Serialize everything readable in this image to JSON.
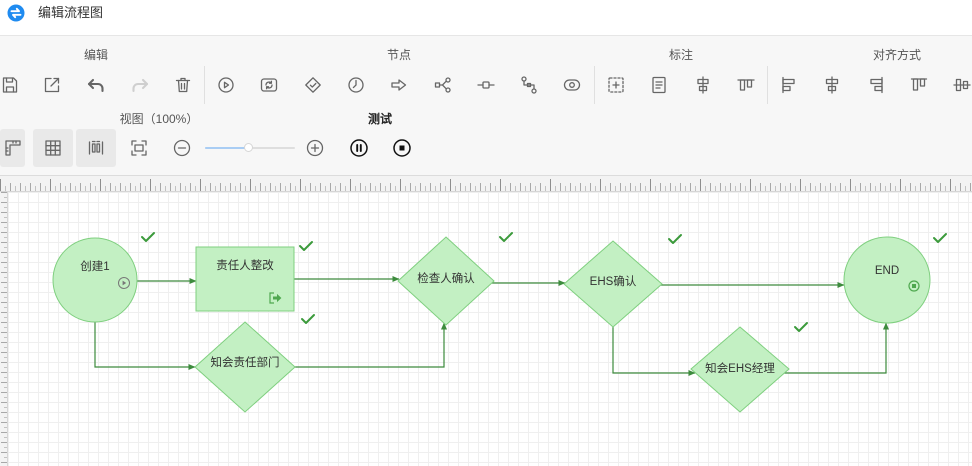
{
  "app": {
    "title": "编辑流程图",
    "logo_icon": "app-logo-icon"
  },
  "toolbar": {
    "edit": {
      "label": "编辑",
      "buttons": [
        {
          "icon": "save-icon"
        },
        {
          "icon": "export-icon"
        },
        {
          "icon": "undo-icon"
        },
        {
          "icon": "redo-icon",
          "disabled": true
        },
        {
          "icon": "delete-icon"
        }
      ]
    },
    "node": {
      "label": "节点",
      "buttons": [
        {
          "icon": "start-node-icon"
        },
        {
          "icon": "sub-process-icon"
        },
        {
          "icon": "gateway-icon"
        },
        {
          "icon": "timer-icon"
        },
        {
          "icon": "send-icon"
        },
        {
          "icon": "branch-icon"
        },
        {
          "icon": "line-node-icon"
        },
        {
          "icon": "connector-icon"
        },
        {
          "icon": "end-node-icon"
        }
      ]
    },
    "annotation": {
      "label": "标注",
      "buttons": [
        {
          "icon": "dashed-box-icon"
        },
        {
          "icon": "document-icon"
        },
        {
          "icon": "align-vertical-icon"
        },
        {
          "icon": "align-horizontal-icon"
        }
      ]
    },
    "align": {
      "label": "对齐方式",
      "buttons": [
        {
          "icon": "align-left-icon"
        },
        {
          "icon": "align-center-icon"
        },
        {
          "icon": "align-right-icon"
        },
        {
          "icon": "align-top-icon"
        },
        {
          "icon": "align-middle-icon"
        }
      ]
    },
    "view": {
      "label": "视图（100%）",
      "zoom_slider_level": 0.48,
      "buttons": [
        {
          "icon": "ruler-icon",
          "active": true
        },
        {
          "icon": "grid-icon",
          "active": true
        },
        {
          "icon": "distribute-icon",
          "active": true
        },
        {
          "icon": "fit-screen-icon"
        },
        {
          "icon": "zoom-out-icon"
        },
        {
          "icon": "zoom-in-icon"
        }
      ]
    },
    "test": {
      "label": "测试",
      "buttons": [
        {
          "icon": "pause-icon"
        },
        {
          "icon": "stop-icon"
        }
      ]
    }
  },
  "diagram": {
    "nodes": [
      {
        "label": "创建1",
        "marker_icon": "play-icon",
        "status_icon": "check-icon"
      },
      {
        "label": "责任人整改",
        "marker_icon": "exit-icon",
        "status_icon": "check-icon"
      },
      {
        "label": "检查人确认",
        "status_icon": "check-icon"
      },
      {
        "label": "EHS确认",
        "status_icon": "check-icon"
      },
      {
        "label": "END",
        "marker_icon": "stop-circle-icon",
        "status_icon": "check-icon"
      },
      {
        "label": "知会责任部门",
        "status_icon": "check-icon"
      },
      {
        "label": "知会EHS经理",
        "status_icon": "check-icon"
      }
    ],
    "edges": [
      {
        "from": 0,
        "to": 1
      },
      {
        "from": 1,
        "to": 2
      },
      {
        "from": 2,
        "to": 3
      },
      {
        "from": 3,
        "to": 4
      },
      {
        "from": 0,
        "to": 5
      },
      {
        "from": 5,
        "to": 2
      },
      {
        "from": 3,
        "to": 6
      },
      {
        "from": 6,
        "to": 4
      }
    ]
  },
  "colors": {
    "accent": "#1f8bf0",
    "node_fill": "#c3f0c3",
    "node_stroke": "#7fcf7f",
    "edge": "#3d8b3d",
    "check": "#3b9a3b",
    "icon": "#666666",
    "icon_disabled": "#cfcfcf",
    "slider": "#a9cdf4"
  }
}
